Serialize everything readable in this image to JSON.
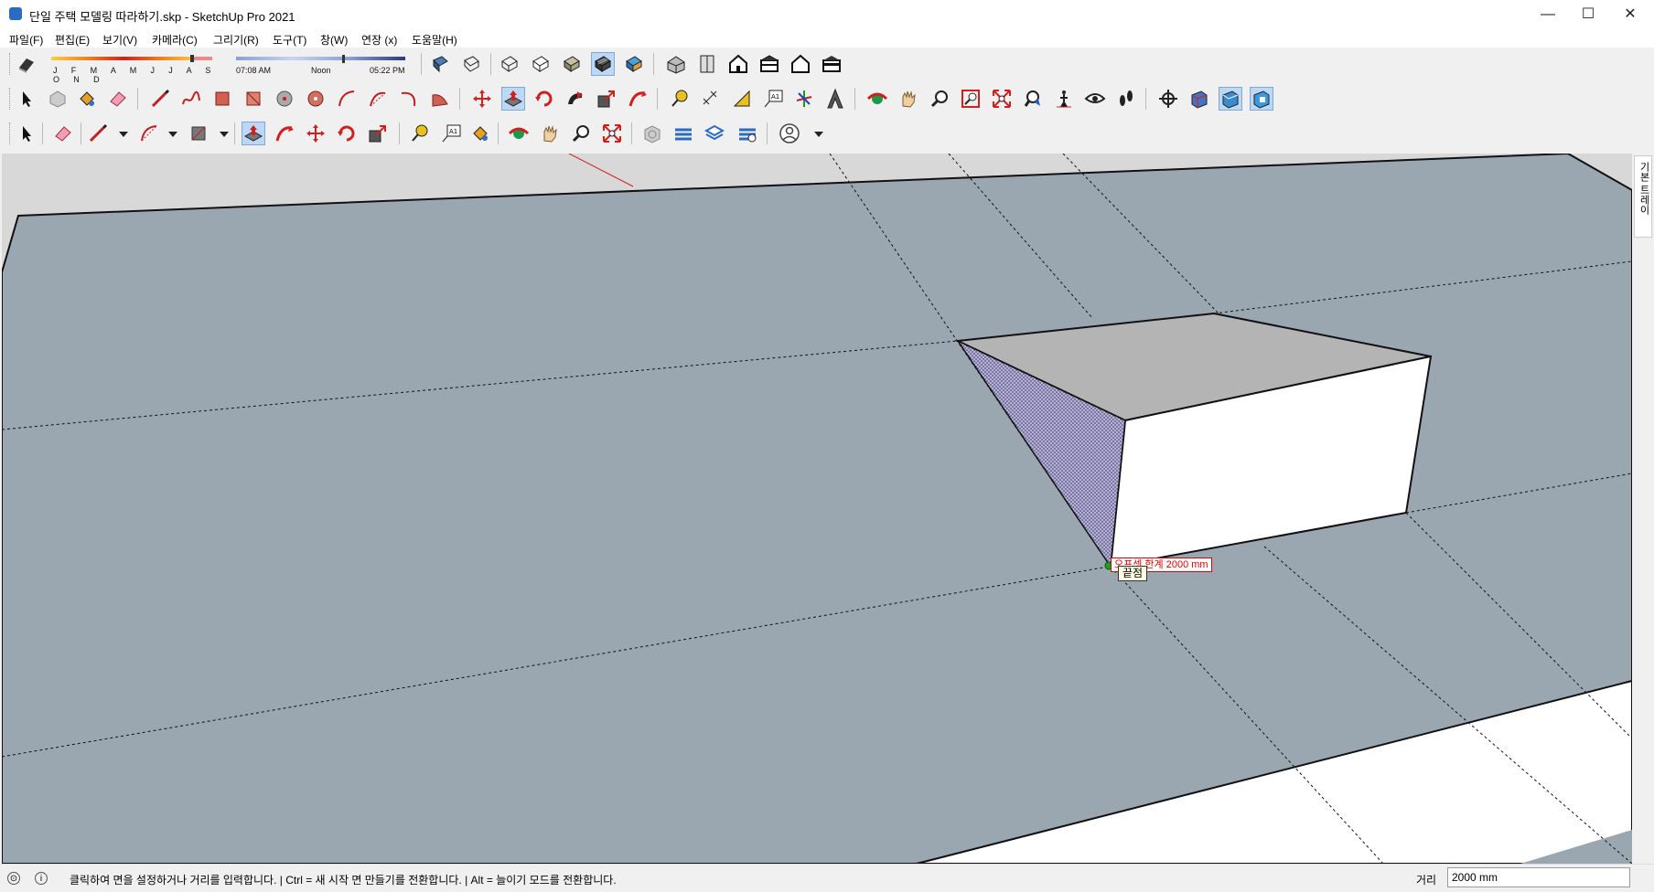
{
  "window": {
    "title": "단일 주택 모델링 따라하기.skp - SketchUp Pro 2021",
    "min_symbol": "—",
    "max_symbol": "☐",
    "close_symbol": "✕"
  },
  "menu": [
    "파일(F)",
    "편집(E)",
    "보기(V)",
    "카메라(C)",
    "그리기(R)",
    "도구(T)",
    "창(W)",
    "연장 (x)",
    "도움말(H)"
  ],
  "shadow_bar": {
    "months": "J F M A M J J A S O N D",
    "time_start": "07:08 AM",
    "time_noon": "Noon",
    "time_end": "05:22 PM"
  },
  "toolbar1": {
    "tools": [
      "eraser-icon",
      "xray-icon",
      "wireframe-icon",
      "hidden-line-icon",
      "shaded-icon",
      "shaded-textures-icon",
      "monochrome-icon",
      "iso-view-icon",
      "top-view-icon",
      "front-view-icon",
      "right-view-icon",
      "back-view-icon",
      "left-view-icon"
    ],
    "active": "shaded-textures-icon"
  },
  "toolbar2": {
    "tools": [
      "select-icon",
      "component-icon",
      "paint-bucket-icon",
      "eraser-icon",
      "line-icon",
      "freehand-icon",
      "rectangle-icon",
      "rotated-rectangle-icon",
      "circle-icon",
      "polygon-icon",
      "arc-icon",
      "two-point-arc-icon",
      "three-point-arc-icon",
      "pie-icon",
      "move-icon",
      "push-pull-icon",
      "rotate-icon",
      "follow-me-icon",
      "scale-icon",
      "offset-icon",
      "tape-measure-icon",
      "dimension-icon",
      "protractor-icon",
      "text-icon",
      "axes-icon",
      "3d-text-icon",
      "orbit-icon",
      "pan-icon",
      "zoom-icon",
      "zoom-window-icon",
      "zoom-extents-icon",
      "previous-view-icon",
      "position-camera-icon",
      "look-around-icon",
      "walk-icon",
      "section-plane-icon",
      "section-display-icon",
      "section-fill-icon",
      "section-cut-icon"
    ],
    "active": "push-pull-icon"
  },
  "toolbar3": {
    "tools": [
      "select-icon",
      "eraser-icon",
      "pencil-icon",
      "dropdown-icon",
      "arc-icon",
      "dropdown-icon",
      "rectangle-icon",
      "dropdown-icon",
      "push-pull-icon",
      "offset-icon",
      "move-icon",
      "rotate-icon",
      "scale-icon",
      "tape-measure-icon",
      "text-icon",
      "paint-bucket-icon",
      "orbit-icon",
      "pan-icon",
      "zoom-icon",
      "zoom-extents-icon",
      "warehouse-icon",
      "extension-warehouse-icon",
      "layout-icon",
      "extension-manager-icon",
      "user-icon",
      "dropdown-icon"
    ],
    "active": "push-pull-icon"
  },
  "viewport": {
    "tooltip_axis": "오프셋 한계 2000 mm",
    "tooltip_endpoint": "끝점"
  },
  "tray": {
    "label": "기본 트레이"
  },
  "status": {
    "message": "클릭하여 면을 설정하거나 거리를 입력합니다. | Ctrl = 새 시작 면 만들기를 전환합니다. | Alt = 늘이기 모드를 전환합니다.",
    "info_icon": "i",
    "geo_icon": "⊙",
    "vcb_label": "거리",
    "vcb_value": "2000 mm"
  },
  "colors": {
    "ground": "#9aa7b0",
    "face_top": "#b4b4b4",
    "face_front": "#ffffff",
    "face_side_selected": "#8a86b0",
    "tooltip_red": "#dd0000",
    "active_tool": "#bcd8f5"
  }
}
